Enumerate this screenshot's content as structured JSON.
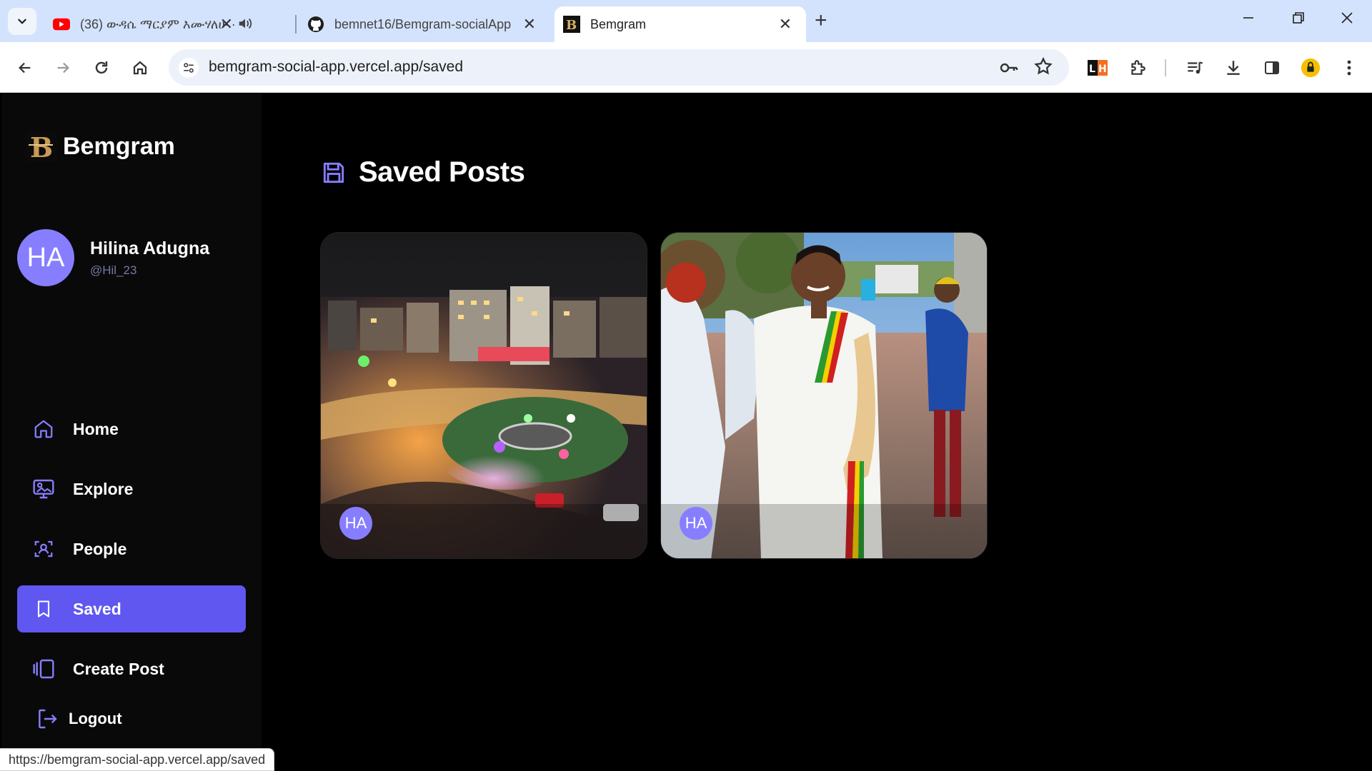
{
  "browser": {
    "tabs": [
      {
        "title": "(36) ውዳሴ ማርያም እሙሃለሁ ·",
        "active": false
      },
      {
        "title": "bemnet16/Bemgram-socialApp",
        "active": false
      },
      {
        "title": "Bemgram",
        "active": true
      }
    ],
    "url": "bemgram-social-app.vercel.app/saved",
    "status_url": "https://bemgram-social-app.vercel.app/saved",
    "icons": {
      "tab_search": "chevron-down-icon",
      "new_tab": "plus-icon",
      "minimize": "minimize-icon",
      "restore": "restore-icon",
      "close": "close-icon"
    }
  },
  "app": {
    "brand": "Bemgram",
    "user": {
      "initials": "HA",
      "name": "Hilina Adugna",
      "handle": "@Hil_23"
    },
    "nav": [
      {
        "label": "Home",
        "icon": "home-icon",
        "active": false
      },
      {
        "label": "Explore",
        "icon": "explore-icon",
        "active": false
      },
      {
        "label": "People",
        "icon": "people-icon",
        "active": false
      },
      {
        "label": "Saved",
        "icon": "bookmark-icon",
        "active": true
      },
      {
        "label": "Create Post",
        "icon": "gallery-add-icon",
        "active": false
      }
    ],
    "logout": "Logout",
    "page_title": "Saved Posts",
    "posts": [
      {
        "avatar": "HA",
        "image": "city-night-roundabout"
      },
      {
        "avatar": "HA",
        "image": "man-in-traditional-white-clothing"
      }
    ],
    "colors": {
      "accent": "#5f57f0",
      "avatar": "#877eff",
      "sidebar": "#09090a",
      "background": "#000000"
    }
  }
}
